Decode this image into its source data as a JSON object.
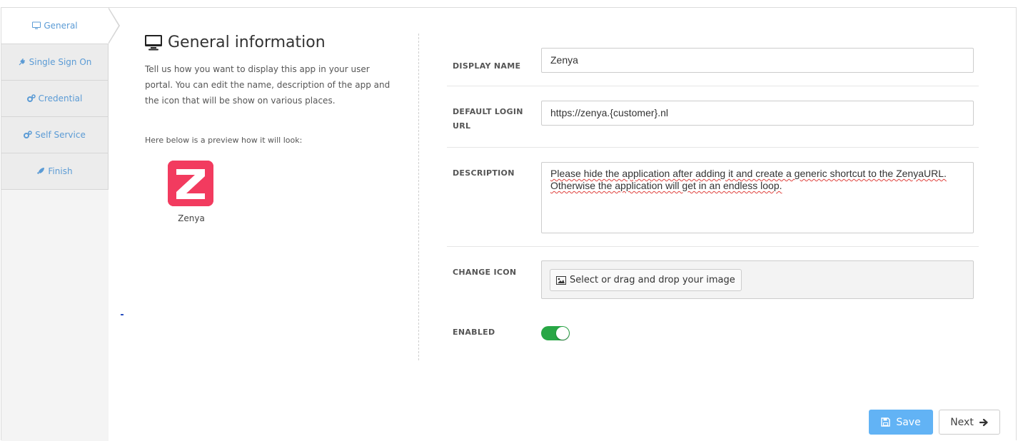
{
  "sidebar": {
    "steps": [
      {
        "label": "General",
        "icon": "monitor-icon",
        "active": true
      },
      {
        "label": "Single Sign On",
        "icon": "plug-icon"
      },
      {
        "label": "Credential",
        "icon": "cogs-icon"
      },
      {
        "label": "Self Service",
        "icon": "cogs-icon"
      },
      {
        "label": "Finish",
        "icon": "rocket-icon"
      }
    ]
  },
  "info": {
    "title": "General information",
    "description": "Tell us how you want to display this app in your user portal. You can edit the name, description of the app and the icon that will be show on various places.",
    "preview_label": "Here below is a preview how it will look:",
    "app_name": "Zenya"
  },
  "form": {
    "display_name_label": "DISPLAY NAME",
    "display_name_value": "Zenya",
    "login_url_label_1": "DEFAULT LOGIN",
    "login_url_label_2": "URL",
    "login_url_value": "https://zenya.{customer}.nl",
    "description_label": "DESCRIPTION",
    "description_line1": "Please hide the application after adding it and create a generic shortcut to the ZenyaURL.",
    "description_line2": "Otherwise the application will get in an endless loop.",
    "change_icon_label": "CHANGE ICON",
    "upload_label": "Select or drag and drop your image",
    "enabled_label": "ENABLED",
    "enabled": true
  },
  "actions": {
    "save_label": "Save",
    "next_label": "Next"
  },
  "colors": {
    "accent": "#5b9bd5",
    "save": "#62b3f5",
    "toggle_on": "#28a745",
    "brand": "#f23b5f"
  }
}
